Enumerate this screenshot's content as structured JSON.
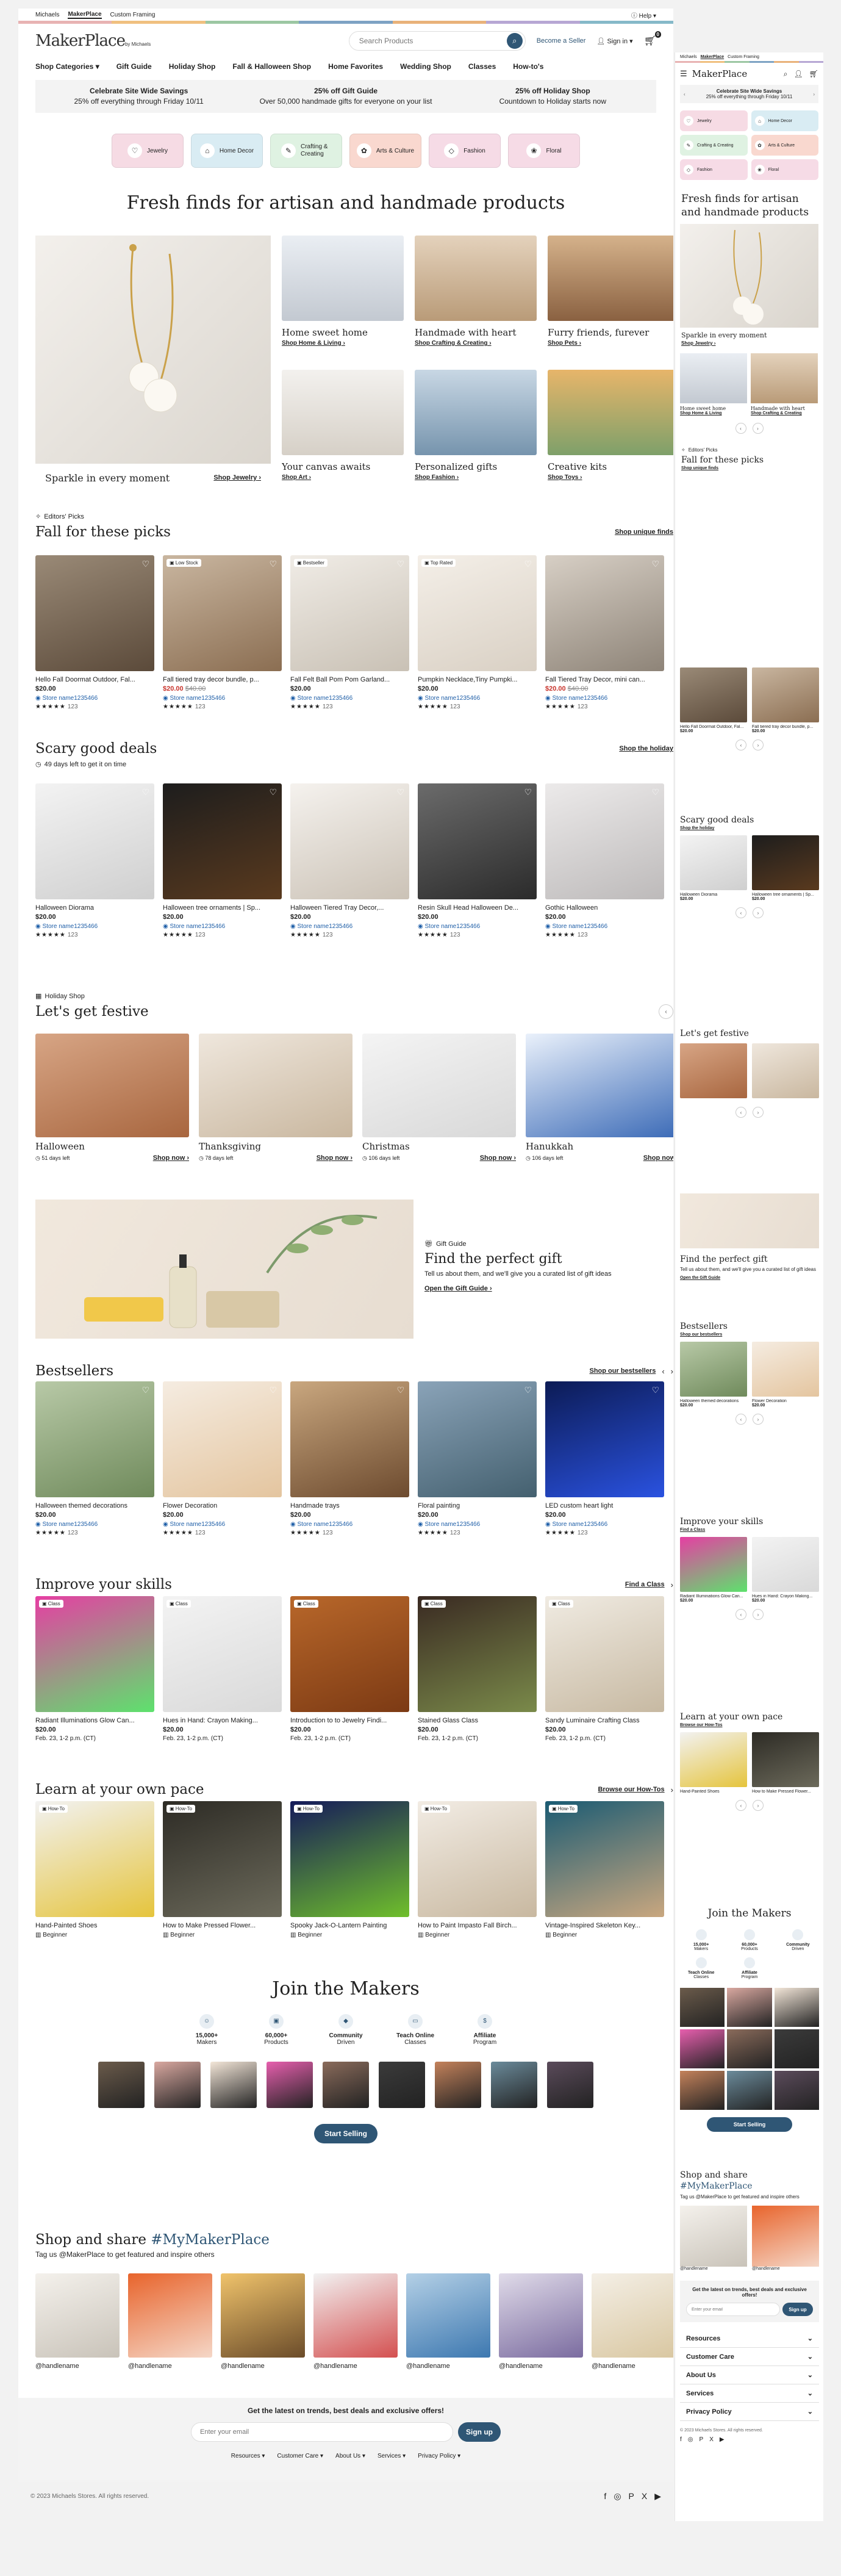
{
  "util": {
    "tabs": [
      "Michaels",
      "MakerPlace",
      "Custom Framing"
    ],
    "active": 1,
    "help": "Help"
  },
  "colors": {
    "accent": "#2f5675",
    "sale": "#c8342c",
    "stripe": [
      "#e8b3b3",
      "#f0c080",
      "#9cc7a3",
      "#7ea3c4",
      "#e9b27a",
      "#b7a7d4",
      "#86b9c9"
    ]
  },
  "header": {
    "logo": "MakerPlace",
    "logo_sub": "by Michaels",
    "search_placeholder": "Search Products",
    "seller": "Become a Seller",
    "signin": "Sign in"
  },
  "nav": [
    "Shop Categories",
    "Gift Guide",
    "Holiday Shop",
    "Fall & Halloween Shop",
    "Home Favorites",
    "Wedding Shop",
    "Classes",
    "How-to's"
  ],
  "promo": [
    {
      "h": "Celebrate Site Wide Savings",
      "s": "25% off everything through Friday 10/11"
    },
    {
      "h": "25% off Gift Guide",
      "s": "Over 50,000 handmade gifts for everyone on your list"
    },
    {
      "h": "25% off Holiday Shop",
      "s": "Countdown to Holiday starts now"
    }
  ],
  "categories": [
    {
      "label": "Jewelry",
      "bg": "#f6dbe4",
      "icon": "♡"
    },
    {
      "label": "Home Decor",
      "bg": "#d9ecf3",
      "icon": "⌂"
    },
    {
      "label": "Crafting & Creating",
      "bg": "#dff2e2",
      "icon": "✎"
    },
    {
      "label": "Arts & Culture",
      "bg": "#f9d8cf",
      "icon": "✿"
    },
    {
      "label": "Fashion",
      "bg": "#f6dbe6",
      "icon": "◇"
    },
    {
      "label": "Floral",
      "bg": "#f6dbe6",
      "icon": "❀"
    }
  ],
  "hero": {
    "title": "Fresh finds for artisan and handmade products",
    "main": {
      "label": "Sparkle in every moment",
      "link": "Shop Jewelry"
    },
    "tiles": [
      {
        "label": "Home sweet home",
        "link": "Shop Home & Living"
      },
      {
        "label": "Handmade with heart",
        "link": "Shop Crafting & Creating"
      },
      {
        "label": "Furry friends, furever",
        "link": "Shop Pets"
      },
      {
        "label": "Your canvas awaits",
        "link": "Shop Art"
      },
      {
        "label": "Personalized gifts",
        "link": "Shop Fashion"
      },
      {
        "label": "Creative kits",
        "link": "Shop Toys"
      }
    ]
  },
  "picks": {
    "eyebrow": "Editors' Picks",
    "title": "Fall for these picks",
    "link": "Shop unique finds",
    "items": [
      {
        "t": "Hello Fall Doormat Outdoor, Fal...",
        "p": "$20.00",
        "store": "Store name1235466",
        "n": "123",
        "badge": ""
      },
      {
        "t": "Fall tiered tray decor bundle, p...",
        "p": "$20.00",
        "was": "$40.00",
        "sale": true,
        "store": "Store name1235466",
        "n": "123",
        "badge": "Low Stock"
      },
      {
        "t": "Fall Felt Ball Pom Pom Garland...",
        "p": "$20.00",
        "store": "Store name1235466",
        "n": "123",
        "badge": "Bestseller"
      },
      {
        "t": "Pumpkin Necklace,Tiny Pumpki...",
        "p": "$20.00",
        "store": "Store name1235466",
        "n": "123",
        "badge": "Top Rated"
      },
      {
        "t": "Fall Tiered Tray Decor, mini can...",
        "p": "$20.00",
        "was": "$40.00",
        "sale": true,
        "store": "Store name1235466",
        "n": "123",
        "badge": ""
      }
    ]
  },
  "deals": {
    "title": "Scary good deals",
    "timer": "49 days left to get it on time",
    "link": "Shop the holiday",
    "items": [
      {
        "t": "Halloween Diorama",
        "p": "$20.00",
        "store": "Store name1235466",
        "n": "123"
      },
      {
        "t": "Halloween tree ornaments | Sp...",
        "p": "$20.00",
        "store": "Store name1235466",
        "n": "123"
      },
      {
        "t": "Halloween Tiered Tray Decor,...",
        "p": "$20.00",
        "store": "Store name1235466",
        "n": "123"
      },
      {
        "t": "Resin Skull Head Halloween De...",
        "p": "$20.00",
        "store": "Store name1235466",
        "n": "123"
      },
      {
        "t": "Gothic Halloween",
        "p": "$20.00",
        "store": "Store name1235466",
        "n": "123"
      }
    ]
  },
  "festive": {
    "eyebrow": "Holiday Shop",
    "title": "Let's get festive",
    "cta": "Shop now",
    "items": [
      {
        "name": "Halloween",
        "days": "51 days left"
      },
      {
        "name": "Thanksgiving",
        "days": "78 days left"
      },
      {
        "name": "Christmas",
        "days": "106 days left"
      },
      {
        "name": "Hanukkah",
        "days": "106 days left"
      }
    ]
  },
  "gift": {
    "eyebrow": "Gift Guide",
    "title": "Find the perfect gift",
    "desc": "Tell us about them, and we'll give you a curated list of gift ideas",
    "link": "Open the Gift Guide"
  },
  "best": {
    "title": "Bestsellers",
    "link": "Shop our bestsellers",
    "items": [
      {
        "t": "Halloween themed decorations",
        "p": "$20.00",
        "store": "Store name1235466",
        "n": "123"
      },
      {
        "t": "Flower Decoration",
        "p": "$20.00",
        "store": "Store name1235466",
        "n": "123"
      },
      {
        "t": "Handmade trays",
        "p": "$20.00",
        "store": "Store name1235466",
        "n": "123"
      },
      {
        "t": "Floral painting",
        "p": "$20.00",
        "store": "Store name1235466",
        "n": "123"
      },
      {
        "t": "LED custom heart light",
        "p": "$20.00",
        "store": "Store name1235466",
        "n": "123"
      }
    ]
  },
  "skills": {
    "title": "Improve your skills",
    "link": "Find a Class",
    "badge": "Class",
    "items": [
      {
        "t": "Radiant Illuminations Glow Can...",
        "p": "$20.00",
        "d": "Feb. 23, 1-2 p.m. (CT)"
      },
      {
        "t": "Hues in Hand: Crayon Making...",
        "p": "$20.00",
        "d": "Feb. 23, 1-2 p.m. (CT)"
      },
      {
        "t": "Introduction to to Jewelry Findi...",
        "p": "$20.00",
        "d": "Feb. 23, 1-2 p.m. (CT)"
      },
      {
        "t": "Stained Glass Class",
        "p": "$20.00",
        "d": "Feb. 23, 1-2 p.m. (CT)"
      },
      {
        "t": "Sandy Luminaire Crafting Class",
        "p": "$20.00",
        "d": "Feb. 23, 1-2 p.m. (CT)"
      }
    ]
  },
  "pace": {
    "title": "Learn at your own pace",
    "link": "Browse our How-Tos",
    "badge": "How-To",
    "level": "Beginner",
    "items": [
      {
        "t": "Hand-Painted Shoes"
      },
      {
        "t": "How to Make Pressed Flower..."
      },
      {
        "t": "Spooky Jack-O-Lantern Painting"
      },
      {
        "t": "How to Paint Impasto Fall Birch..."
      },
      {
        "t": "Vintage-Inspired Skeleton Key..."
      }
    ]
  },
  "makers": {
    "title": "Join the Makers",
    "stats": [
      {
        "v": "15,000+",
        "l": "Makers"
      },
      {
        "v": "60,000+",
        "l": "Products"
      },
      {
        "v": "Community",
        "l": "Driven"
      },
      {
        "v": "Teach Online",
        "l": "Classes"
      },
      {
        "v": "Affiliate",
        "l": "Program"
      }
    ],
    "cta": "Start Selling"
  },
  "share": {
    "title": "Shop and share",
    "tag": "#MyMakerPlace",
    "desc": "Tag us @MakerPlace to get featured and inspire others",
    "handle": "@handlename"
  },
  "newsletter": {
    "title": "Get the latest on trends, best deals and exclusive offers!",
    "placeholder": "Enter your email",
    "cta": "Sign up"
  },
  "footer": {
    "links": [
      "Resources",
      "Customer Care",
      "About Us",
      "Services",
      "Privacy Policy"
    ],
    "copy": "© 2023 Michaels Stores. All rights reserved.",
    "social": [
      "f",
      "◎",
      "P",
      "X",
      "▶"
    ]
  },
  "mobile": {
    "hero_title": "Fresh finds for artisan and handmade products",
    "picks_link": "Shop unique finds",
    "deals_timer": "49 days left to get it on time",
    "deals_link": "Shop the holiday",
    "gift_desc": "Tell us about them, and we'll give you a curated list of gift ideas"
  }
}
